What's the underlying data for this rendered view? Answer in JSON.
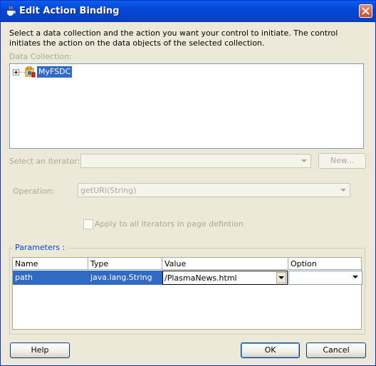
{
  "window": {
    "title": "Edit Action Binding"
  },
  "description": "Select a data collection and the action you want your control to initiate. The control initiates the action on the data objects of the selected collection.",
  "data_collection": {
    "label": "Data Collection:",
    "tree": [
      {
        "label": "MyFSDC",
        "selected": true,
        "expandable": true
      }
    ]
  },
  "iterator": {
    "label": "Select an Iterator:",
    "value": "",
    "new_button": "New..."
  },
  "operation": {
    "label": "Operation:",
    "value": "getURI(String)"
  },
  "apply_all": {
    "label": "Apply to all iterators in page defintion",
    "checked": false
  },
  "parameters": {
    "label": "Parameters :",
    "columns": [
      "Name",
      "Type",
      "Value",
      "Option"
    ],
    "rows": [
      {
        "name": "path",
        "type": "java.lang.String",
        "value": "/PlasmaNews.html",
        "option": ""
      }
    ]
  },
  "buttons": {
    "help": "Help",
    "ok": "OK",
    "cancel": "Cancel"
  },
  "colors": {
    "title_bar": "#0646d6",
    "selection": "#316ac5",
    "dialog_bg": "#ece9d8"
  }
}
